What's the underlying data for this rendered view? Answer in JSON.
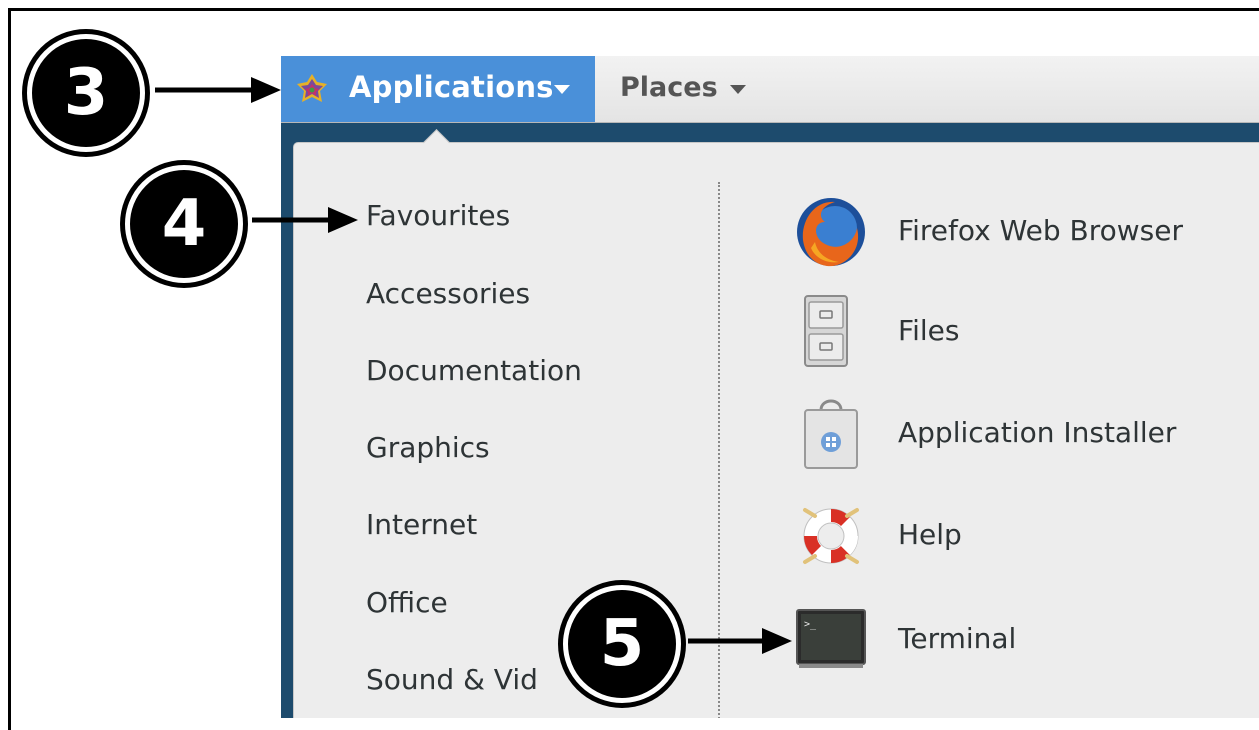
{
  "topbar": {
    "applications_label": "Applications",
    "places_label": "Places"
  },
  "menu": {
    "categories": [
      "Favourites",
      "Accessories",
      "Documentation",
      "Graphics",
      "Internet",
      "Office",
      "Sound & Vid"
    ],
    "apps": [
      {
        "label": "Firefox Web Browser",
        "icon": "firefox-icon"
      },
      {
        "label": "Files",
        "icon": "file-cabinet-icon"
      },
      {
        "label": "Application Installer",
        "icon": "shopping-bag-icon"
      },
      {
        "label": "Help",
        "icon": "lifebuoy-icon"
      },
      {
        "label": "Terminal",
        "icon": "terminal-icon"
      }
    ]
  },
  "callouts": [
    "3",
    "4",
    "5"
  ],
  "colors": {
    "accent": "#4a90d9",
    "desktop": "#1d4b6d",
    "menu_bg": "#ededed",
    "text": "#2e3436"
  }
}
